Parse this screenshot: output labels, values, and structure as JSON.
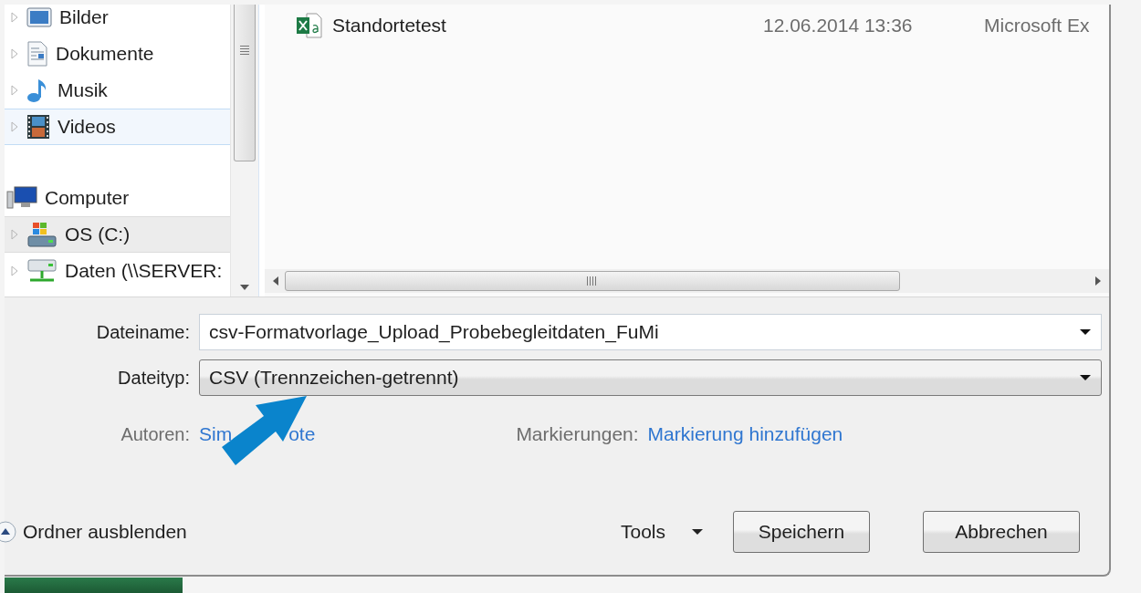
{
  "navigation": {
    "groups": [
      {
        "items": [
          {
            "label": "Bilder",
            "kind": "pictures",
            "selected": false,
            "hovered": false
          },
          {
            "label": "Dokumente",
            "kind": "documents",
            "selected": false,
            "hovered": false
          },
          {
            "label": "Musik",
            "kind": "music",
            "selected": false,
            "hovered": false
          },
          {
            "label": "Videos",
            "kind": "videos",
            "selected": false,
            "hovered": true
          }
        ]
      },
      {
        "header": {
          "label": "Computer",
          "kind": "computer"
        },
        "items": [
          {
            "label": "OS (C:)",
            "kind": "drive",
            "selected": true,
            "hovered": false
          },
          {
            "label": "Daten (\\\\SERVER:",
            "kind": "network",
            "selected": false,
            "hovered": false
          }
        ]
      }
    ]
  },
  "files": [
    {
      "name": "Standortetest",
      "kind": "excel",
      "date": "12.06.2014 13:36",
      "type": "Microsoft Ex"
    }
  ],
  "form": {
    "filename_label": "Dateiname:",
    "filename": "csv-Formatvorlage_Upload_Probebegleitdaten_FuMi",
    "filetype_label": "Dateityp:",
    "filetype": "CSV (Trennzeichen-getrennt)",
    "authors_label": "Autoren:",
    "authors_parts": [
      "Sim",
      "ote"
    ],
    "tags_label": "Markierungen:",
    "tags_link": "Markierung hinzufügen"
  },
  "footer": {
    "hide_folders": "Ordner ausblenden",
    "tools": "Tools",
    "buttons": [
      "Speichern",
      "Abbrechen"
    ]
  }
}
